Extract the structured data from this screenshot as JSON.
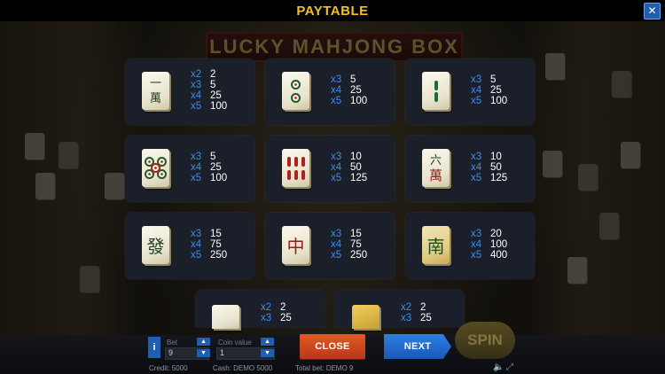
{
  "header": {
    "title": "PAYTABLE",
    "close_glyph": "✕"
  },
  "background_logo": "LUCKY MAHJONG BOX",
  "symbols": [
    {
      "name": "one-character-tile",
      "glyph": "一萬",
      "pays": [
        {
          "mult": "x2",
          "value": "2"
        },
        {
          "mult": "x3",
          "value": "5"
        },
        {
          "mult": "x4",
          "value": "25"
        },
        {
          "mult": "x5",
          "value": "100"
        }
      ]
    },
    {
      "name": "two-circles-tile",
      "glyph": "",
      "pays": [
        {
          "mult": "x3",
          "value": "5"
        },
        {
          "mult": "x4",
          "value": "25"
        },
        {
          "mult": "x5",
          "value": "100"
        }
      ]
    },
    {
      "name": "two-bamboo-tile",
      "glyph": "",
      "pays": [
        {
          "mult": "x3",
          "value": "5"
        },
        {
          "mult": "x4",
          "value": "25"
        },
        {
          "mult": "x5",
          "value": "100"
        }
      ]
    },
    {
      "name": "five-circles-tile",
      "glyph": "",
      "pays": [
        {
          "mult": "x3",
          "value": "5"
        },
        {
          "mult": "x4",
          "value": "25"
        },
        {
          "mult": "x5",
          "value": "100"
        }
      ]
    },
    {
      "name": "six-bamboo-tile",
      "glyph": "",
      "pays": [
        {
          "mult": "x3",
          "value": "10"
        },
        {
          "mult": "x4",
          "value": "50"
        },
        {
          "mult": "x5",
          "value": "125"
        }
      ]
    },
    {
      "name": "six-character-tile",
      "glyph": "六萬",
      "pays": [
        {
          "mult": "x3",
          "value": "10"
        },
        {
          "mult": "x4",
          "value": "50"
        },
        {
          "mult": "x5",
          "value": "125"
        }
      ]
    },
    {
      "name": "green-dragon-tile",
      "glyph": "發",
      "pays": [
        {
          "mult": "x3",
          "value": "15"
        },
        {
          "mult": "x4",
          "value": "75"
        },
        {
          "mult": "x5",
          "value": "250"
        }
      ]
    },
    {
      "name": "red-dragon-tile",
      "glyph": "中",
      "pays": [
        {
          "mult": "x3",
          "value": "15"
        },
        {
          "mult": "x4",
          "value": "75"
        },
        {
          "mult": "x5",
          "value": "250"
        }
      ]
    },
    {
      "name": "south-wind-tile",
      "glyph": "南",
      "pays": [
        {
          "mult": "x3",
          "value": "20"
        },
        {
          "mult": "x4",
          "value": "100"
        },
        {
          "mult": "x5",
          "value": "400"
        }
      ]
    },
    {
      "name": "partial-tile-left",
      "glyph": "",
      "pays": [
        {
          "mult": "x2",
          "value": "2"
        },
        {
          "mult": "x3",
          "value": "25"
        }
      ]
    },
    {
      "name": "partial-tile-right",
      "glyph": "",
      "pays": [
        {
          "mult": "x2",
          "value": "2"
        },
        {
          "mult": "x3",
          "value": "25"
        }
      ]
    }
  ],
  "controls": {
    "info_label": "i",
    "bet_label": "Bet",
    "bet_value": "9",
    "coin_label": "Coin value",
    "coin_value": "1",
    "close_label": "CLOSE",
    "next_label": "NEXT",
    "spin_label": "SPIN"
  },
  "status": {
    "credit": "Credit: 5000",
    "cash": "Cash: DEMO 5000",
    "total_bet": "Total bet: DEMO 9"
  },
  "colors": {
    "title": "#f2c21b",
    "multiplier": "#3d8df0",
    "close_button": "#d14a20",
    "next_button": "#2a6fd6"
  }
}
